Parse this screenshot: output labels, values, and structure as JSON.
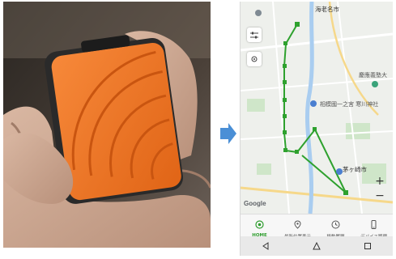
{
  "map": {
    "labels": {
      "ebina": "海老名市",
      "keio": "慶應義塾大",
      "samukawa": "寒川神社",
      "sagamikokubun": "相模國一之宮 寒川神社",
      "chigasaki": "茅ヶ崎市"
    },
    "google_logo": "Google",
    "route_color": "#2ea12e",
    "zoom_in": "+",
    "zoom_out": "−"
  },
  "tabs": [
    {
      "label": "HOME",
      "icon": "target-icon",
      "active": true
    },
    {
      "label": "最新位置表示",
      "icon": "location-pin-icon",
      "active": false
    },
    {
      "label": "移動履歴",
      "icon": "clock-icon",
      "active": false
    },
    {
      "label": "デバイス管理",
      "icon": "phone-icon",
      "active": false
    }
  ],
  "accent": "#2e9c2e",
  "arrow_color": "#4a8fd6",
  "device_color": "#f07a2a"
}
